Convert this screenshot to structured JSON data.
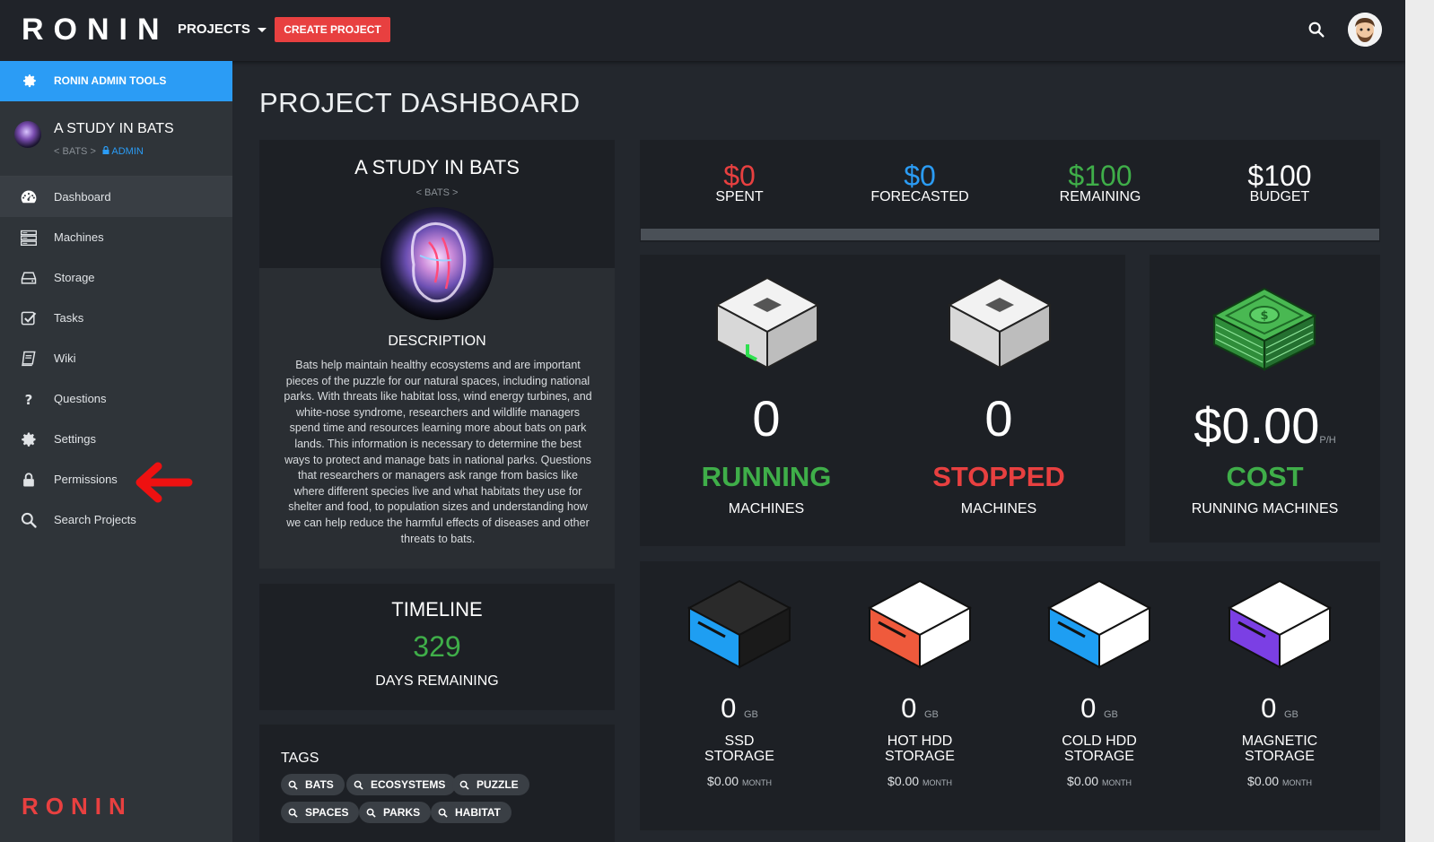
{
  "topbar": {
    "logo": "RONIN",
    "projects_label": "PROJECTS",
    "create_label": "CREATE PROJECT"
  },
  "sidebar": {
    "admin_tools": "RONIN ADMIN TOOLS",
    "project_title": "A STUDY IN BATS",
    "project_path": "< BATS >",
    "project_role": "ADMIN",
    "items": [
      {
        "label": "Dashboard",
        "icon": "dashboard-icon"
      },
      {
        "label": "Machines",
        "icon": "machines-icon"
      },
      {
        "label": "Storage",
        "icon": "storage-icon"
      },
      {
        "label": "Tasks",
        "icon": "tasks-icon"
      },
      {
        "label": "Wiki",
        "icon": "wiki-icon"
      },
      {
        "label": "Questions",
        "icon": "question-icon"
      },
      {
        "label": "Settings",
        "icon": "gear-icon"
      },
      {
        "label": "Permissions",
        "icon": "lock-icon"
      },
      {
        "label": "Search Projects",
        "icon": "search-icon"
      }
    ],
    "bottom_logo": "RONIN"
  },
  "main": {
    "page_title": "PROJECT DASHBOARD",
    "project": {
      "title": "A STUDY IN BATS",
      "subtitle": "< BATS >",
      "description_heading": "DESCRIPTION",
      "description": "Bats help maintain healthy ecosystems and are important pieces of the puzzle for our natural spaces, including national parks. With threats like habitat loss, wind energy turbines, and white-nose syndrome, researchers and wildlife managers spend time and resources learning more about bats on park lands. This information is necessary to determine the best ways to protect and manage bats in national parks. Questions that researchers or managers ask range from basics like where different species live and what habitats they use for shelter and food, to population sizes and understanding how we can help reduce the harmful effects of diseases and other threats to bats."
    },
    "timeline": {
      "heading": "TIMELINE",
      "days": "329",
      "days_label": "DAYS REMAINING"
    },
    "tags": {
      "heading": "TAGS",
      "items": [
        "BATS",
        "ECOSYSTEMS",
        "PUZZLE",
        "SPACES",
        "PARKS",
        "HABITAT"
      ]
    },
    "budget": {
      "spent": "$0",
      "spent_label": "SPENT",
      "forecasted": "$0",
      "forecasted_label": "FORECASTED",
      "remaining": "$100",
      "remaining_label": "REMAINING",
      "budget": "$100",
      "budget_label": "BUDGET",
      "progress": 0
    },
    "machines": {
      "running_count": "0",
      "running_label": "RUNNING",
      "running_sub": "MACHINES",
      "stopped_count": "0",
      "stopped_label": "STOPPED",
      "stopped_sub": "MACHINES",
      "cost": "$0.00",
      "cost_unit": "P/H",
      "cost_label": "COST",
      "cost_sub": "RUNNING MACHINES"
    },
    "storage": [
      {
        "value": "0",
        "unit": "GB",
        "line1": "SSD",
        "line2": "STORAGE",
        "cost": "$0.00",
        "cost_unit": "MONTH"
      },
      {
        "value": "0",
        "unit": "GB",
        "line1": "HOT HDD",
        "line2": "STORAGE",
        "cost": "$0.00",
        "cost_unit": "MONTH"
      },
      {
        "value": "0",
        "unit": "GB",
        "line1": "COLD HDD",
        "line2": "STORAGE",
        "cost": "$0.00",
        "cost_unit": "MONTH"
      },
      {
        "value": "0",
        "unit": "GB",
        "line1": "MAGNETIC",
        "line2": "STORAGE",
        "cost": "$0.00",
        "cost_unit": "MONTH"
      }
    ],
    "colors": {
      "accent_blue": "#2b9cf5",
      "red": "#e84040",
      "green": "#3fae49",
      "purple": "#7b3fe4"
    }
  }
}
